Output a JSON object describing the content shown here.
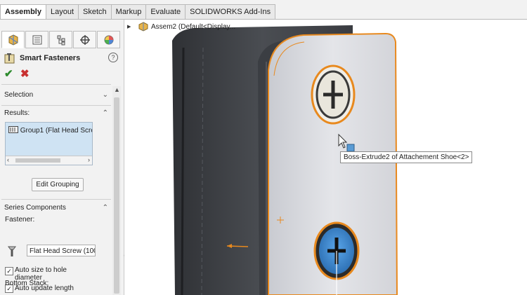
{
  "command_tabs": [
    {
      "label": "Assembly",
      "active": true
    },
    {
      "label": "Layout",
      "active": false
    },
    {
      "label": "Sketch",
      "active": false
    },
    {
      "label": "Markup",
      "active": false
    },
    {
      "label": "Evaluate",
      "active": false
    },
    {
      "label": "SOLIDWORKS Add-Ins",
      "active": false
    }
  ],
  "manager_tabs": [
    "featuremanager-icon",
    "propertymanager-icon",
    "configurationmanager-icon",
    "dimxpert-icon",
    "appearance-icon"
  ],
  "property_manager": {
    "title": "Smart Fasteners",
    "help": "?",
    "ok_glyph": "✔",
    "cancel_glyph": "✖",
    "selection": {
      "label": "Selection"
    },
    "results": {
      "label": "Results:",
      "items": [
        "Group1 (Flat Head Scre"
      ],
      "edit_grouping_label": "Edit Grouping"
    },
    "series_components": {
      "label": "Series Components",
      "fastener_label": "Fastener:",
      "fastener_value": "Flat Head Screw (100",
      "auto_size_label_line1": "Auto size to hole",
      "auto_size_label_line2": "diameter",
      "auto_size_checked": true,
      "auto_update_label": "Auto update length",
      "auto_update_checked": true,
      "bottom_stack_label": "Bottom Stack:"
    }
  },
  "graphics": {
    "tree_root_label": "Assem2 (Default<Display...",
    "tooltip": "Boss-Extrude2 of Attachement Shoe<2>",
    "colors": {
      "selection_orange": "#e8891e",
      "hole_blue": "#3c8fd6",
      "dark_part": "#3d4045",
      "light_part": "#dcdde1"
    }
  }
}
